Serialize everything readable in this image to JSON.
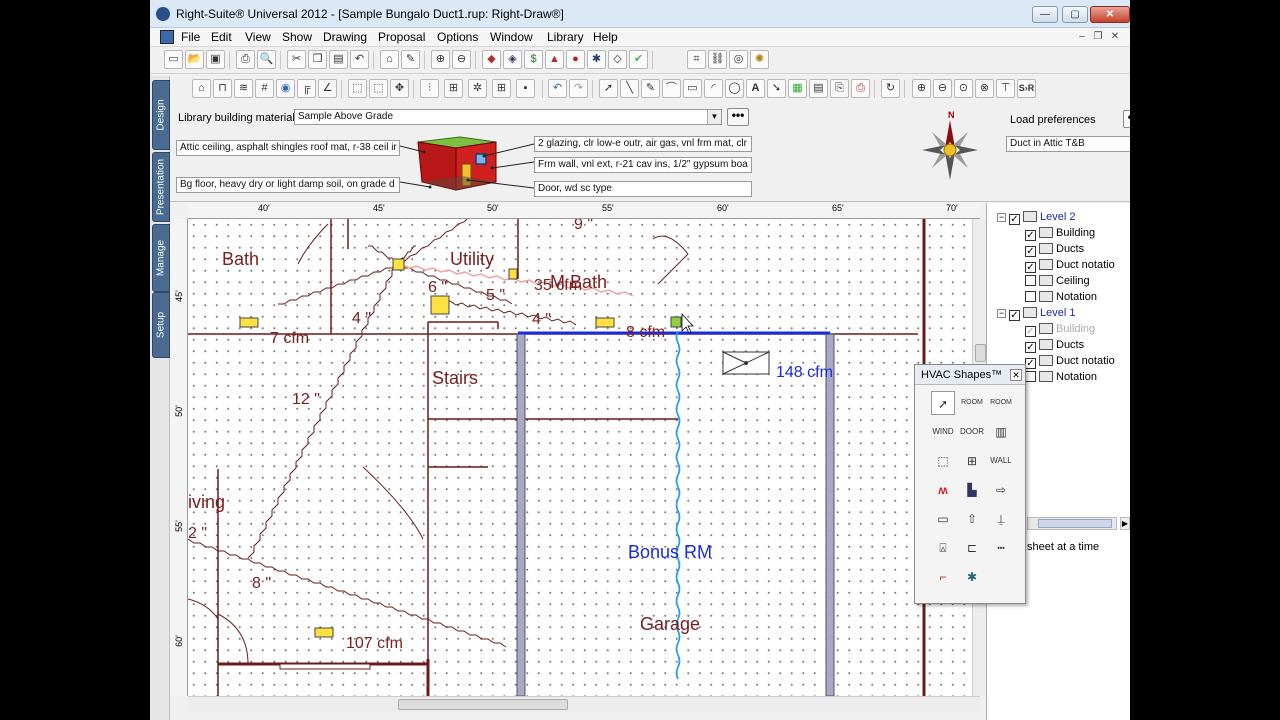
{
  "window": {
    "title": "Right-Suite® Universal 2012 - [Sample Bungalo Duct1.rup: Right-Draw®]",
    "min": "—",
    "max": "▢",
    "close": "✕"
  },
  "menu": [
    "File",
    "Edit",
    "View",
    "Show",
    "Drawing",
    "Proposal",
    "Options",
    "Window",
    "Library",
    "Help"
  ],
  "side_tabs": [
    "Design",
    "Presentation",
    "Manage",
    "Setup"
  ],
  "properties": {
    "library_label": "Library building materials",
    "library_value": "Sample Above Grade",
    "attic": "Attic ceiling, asphalt shingles roof mat, r-38 ceil ir",
    "floor": "Bg floor, heavy dry or light damp soil, on grade d",
    "glazing": "2 glazing, clr low-e outr, air gas, vnl frm mat, clr",
    "wall": "Frm wall, vnl ext, r-21 cav ins, 1/2\" gypsum boa",
    "door": "Door, wd sc type",
    "compass_n": "N",
    "load_pref_label": "Load preferences",
    "load_pref_value": "Duct in Attic T&B",
    "more": "•••"
  },
  "ruler": {
    "top": [
      "40'",
      "45'",
      "50'",
      "55'",
      "60'",
      "65'",
      "70'"
    ],
    "left": [
      "45'",
      "50'",
      "55'",
      "60'"
    ]
  },
  "drawing": {
    "rooms": [
      "Bath",
      "Utility",
      "M Bath",
      "Stairs",
      "Bonus RM",
      "Garage",
      "iving"
    ],
    "duct_labels": [
      "9 \"",
      "6 \"",
      "5 \"",
      "4 \"",
      "4 \"",
      "12 \"",
      "2 \"",
      "8 \""
    ],
    "cfm_labels": [
      "35 cfm",
      "7 cfm",
      "8 cfm",
      "107 cfm"
    ],
    "supply_cfm": "148 cfm"
  },
  "tree": {
    "level2": "Level 2",
    "level2_items": [
      "Building",
      "Ducts",
      "Duct notatio",
      "Ceiling",
      "Notation"
    ],
    "level1": "Level 1",
    "level1_items": [
      "Building",
      "Ducts",
      "Duct notatio",
      "Notation"
    ],
    "sheet_hint": "sheet at a time"
  },
  "palette": {
    "title": "HVAC Shapes™",
    "tools": [
      "pointer",
      "room",
      "room-2",
      "wind",
      "door",
      "wall-hatch",
      "box",
      "window-grid",
      "wall",
      "radiant",
      "unit",
      "arrow-box",
      "box-arrow",
      "up-arrow",
      "register",
      "boot",
      "fitting",
      "bar",
      "duct",
      "fan"
    ]
  }
}
